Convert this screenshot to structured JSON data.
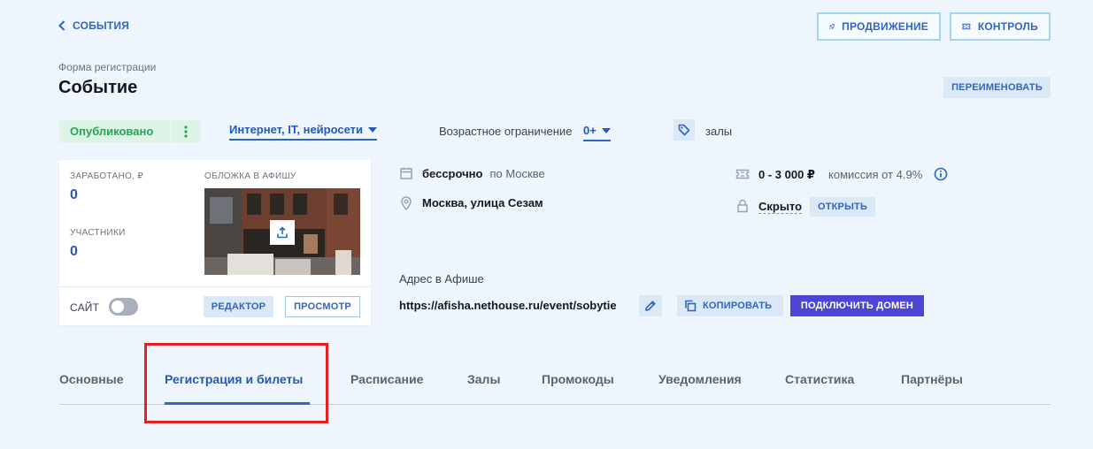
{
  "header": {
    "back_label": "СОБЫТИЯ",
    "promo_label": "ПРОДВИЖЕНИЕ",
    "control_label": "КОНТРОЛЬ",
    "form_label": "Форма регистрации",
    "title": "Событие",
    "rename_label": "ПЕРЕИМЕНОВАТЬ"
  },
  "meta": {
    "status": "Опубликовано",
    "category": "Интернет, IT, нейросети",
    "age_label": "Возрастное ограничение",
    "age_value": "0+",
    "halls_label": "залы"
  },
  "card": {
    "earned_label": "ЗАРАБОТАНО, ₽",
    "earned_value": "0",
    "participants_label": "УЧАСТНИКИ",
    "participants_value": "0",
    "cover_label": "ОБЛОЖКА В АФИШУ",
    "site_label": "САЙТ",
    "site_enabled": false,
    "editor_label": "РЕДАКТОР",
    "preview_label": "ПРОСМОТР"
  },
  "details": {
    "date_bold": "бессрочно",
    "date_light": "по Москве",
    "address": "Москва, улица Сезам",
    "price": "0 - 3 000 ₽",
    "commission": "комиссия от 4.9%",
    "visibility": "Скрыто",
    "open_label": "ОТКРЫТЬ"
  },
  "afisha": {
    "label": "Адрес в Афише",
    "url": "https://afisha.nethouse.ru/event/sobytie",
    "copy_label": "КОПИРОВАТЬ",
    "domain_label": "ПОДКЛЮЧИТЬ ДОМЕН"
  },
  "tabs": [
    {
      "label": "Основные",
      "active": false
    },
    {
      "label": "Регистрация и билеты",
      "active": true
    },
    {
      "label": "Расписание",
      "active": false
    },
    {
      "label": "Залы",
      "active": false
    },
    {
      "label": "Промокоды",
      "active": false
    },
    {
      "label": "Уведомления",
      "active": false
    },
    {
      "label": "Статистика",
      "active": false
    },
    {
      "label": "Партнёры",
      "active": false
    }
  ],
  "colors": {
    "background": "#eef5fc",
    "accent": "#2f66c4",
    "published": "#29a35a",
    "domain_button": "#4c46d6",
    "highlight": "#e32021"
  },
  "icons": {
    "back": "chevron-left-icon",
    "promo": "rocket-icon",
    "control": "ticket-icon",
    "menu": "kebab-menu-icon",
    "tag": "tag-icon",
    "upload": "upload-icon",
    "calendar": "calendar-icon",
    "location": "location-pin-icon",
    "price": "ticket-icon",
    "info": "info-icon",
    "lock": "lock-icon",
    "edit": "pencil-icon",
    "copy": "copy-icon"
  }
}
